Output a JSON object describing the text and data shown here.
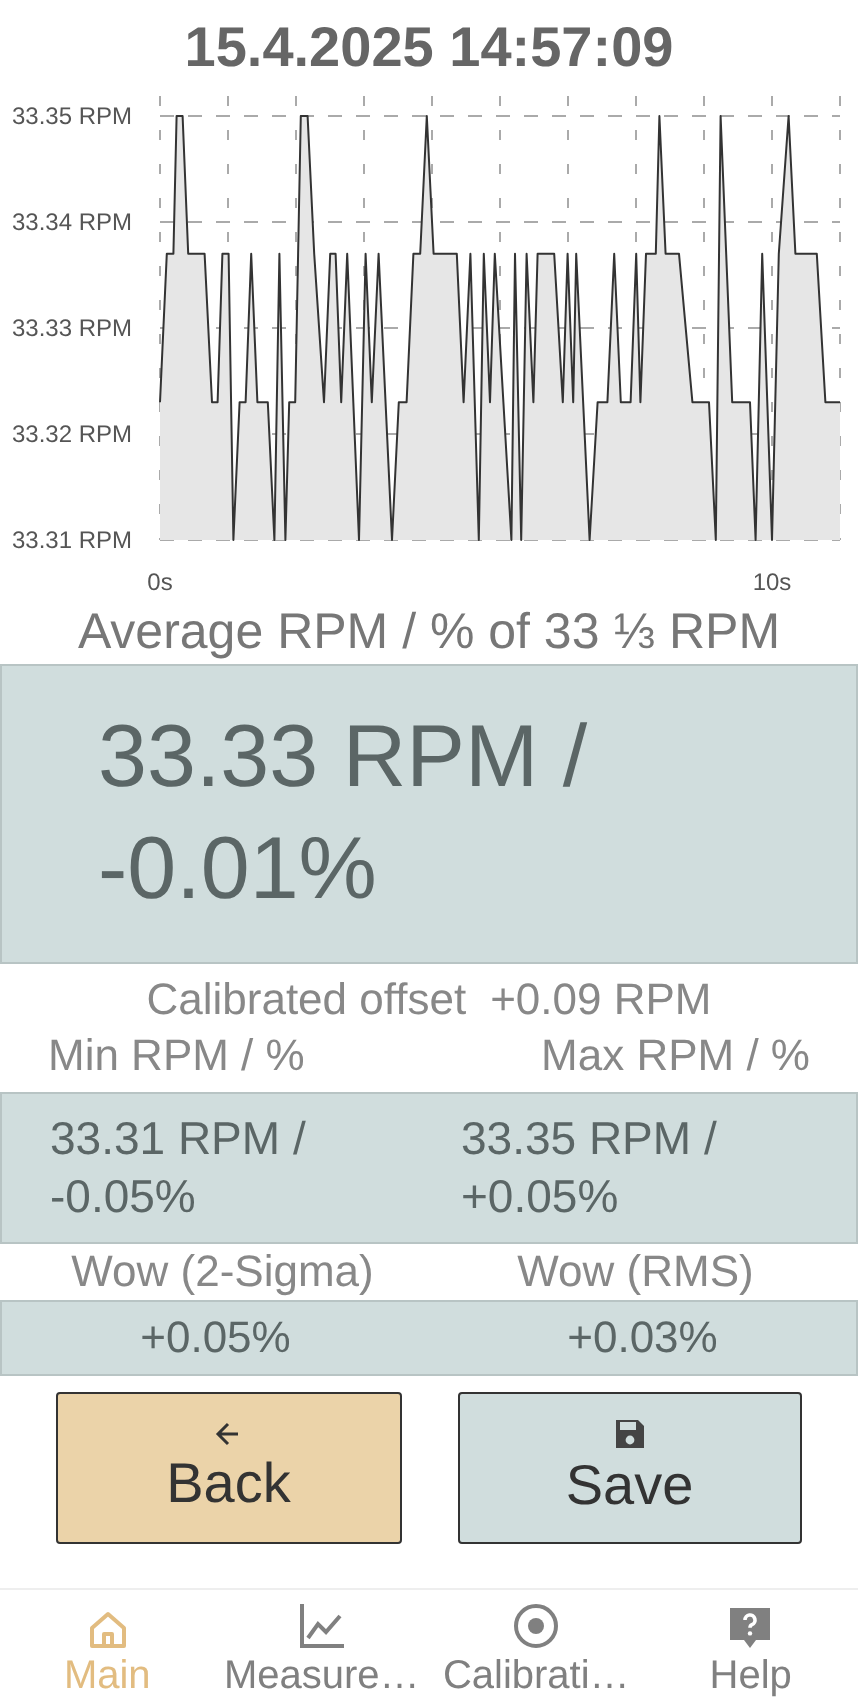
{
  "title": "15.4.2025 14:57:09",
  "chart": {
    "chart_data": {
      "type": "area",
      "x": [
        0,
        0.11,
        0.22,
        0.27,
        0.37,
        0.46,
        0.73,
        0.85,
        0.94,
        1.02,
        1.12,
        1.2,
        1.3,
        1.4,
        1.49,
        1.59,
        1.76,
        1.87,
        1.95,
        2.05,
        2.11,
        2.21,
        2.3,
        2.41,
        2.52,
        2.68,
        2.78,
        2.87,
        2.96,
        3.06,
        3.25,
        3.36,
        3.46,
        3.57,
        3.79,
        3.9,
        4.03,
        4.14,
        4.25,
        4.36,
        4.47,
        4.85,
        4.96,
        5.07,
        5.21,
        5.29,
        5.39,
        5.47,
        5.61,
        5.74,
        5.8,
        5.9,
        5.99,
        6.1,
        6.17,
        6.44,
        6.58,
        6.66,
        6.75,
        6.8,
        7.02,
        7.15,
        7.31,
        7.42,
        7.53,
        7.69,
        7.78,
        7.85,
        7.94,
        8.1,
        8.16,
        8.26,
        8.48,
        8.7,
        8.97,
        9.08,
        9.16,
        9.35,
        9.64,
        9.73,
        9.84,
        10,
        10.11,
        10.27,
        10.38,
        10.73,
        10.87,
        11.11
      ],
      "series": [
        {
          "color": "#333333",
          "values": [
            33.323,
            33.337,
            33.337,
            33.35,
            33.35,
            33.337,
            33.337,
            33.323,
            33.323,
            33.337,
            33.337,
            33.31,
            33.323,
            33.323,
            33.337,
            33.323,
            33.323,
            33.31,
            33.337,
            33.31,
            33.323,
            33.323,
            33.35,
            33.35,
            33.337,
            33.323,
            33.337,
            33.337,
            33.323,
            33.337,
            33.31,
            33.337,
            33.323,
            33.337,
            33.31,
            33.323,
            33.323,
            33.337,
            33.337,
            33.35,
            33.337,
            33.337,
            33.323,
            33.337,
            33.31,
            33.337,
            33.323,
            33.337,
            33.323,
            33.31,
            33.337,
            33.31,
            33.337,
            33.323,
            33.337,
            33.337,
            33.323,
            33.337,
            33.323,
            33.337,
            33.31,
            33.323,
            33.323,
            33.337,
            33.323,
            33.323,
            33.337,
            33.323,
            33.337,
            33.337,
            33.35,
            33.337,
            33.337,
            33.323,
            33.323,
            33.31,
            33.35,
            33.323,
            33.323,
            33.31,
            33.337,
            33.31,
            33.337,
            33.35,
            33.337,
            33.337,
            33.323,
            33.323
          ]
        }
      ],
      "grid": true,
      "xlim": [
        0,
        11.11
      ],
      "ylim": [
        33.31,
        33.35
      ],
      "xticks": [
        {
          "value": 0,
          "label": "0s"
        },
        {
          "value": 10,
          "label": "10s"
        }
      ],
      "yticks": [
        {
          "value": 33.35,
          "label": "33.35 RPM"
        },
        {
          "value": 33.34,
          "label": "33.34 RPM"
        },
        {
          "value": 33.33,
          "label": "33.33 RPM"
        },
        {
          "value": 33.32,
          "label": "33.32 RPM"
        },
        {
          "value": 33.31,
          "label": "33.31 RPM"
        }
      ]
    }
  },
  "average": {
    "label": "Average RPM / % of 33 ⅓ RPM",
    "value": "33.33 RPM / -0.01%"
  },
  "calibrated_offset": {
    "label": "Calibrated offset",
    "value": "+0.09 RPM"
  },
  "stats": [
    {
      "label": "Min RPM / %",
      "value": "33.31 RPM / -0.05%"
    },
    {
      "label": "Max RPM / %",
      "value": "33.35 RPM / +0.05%"
    }
  ],
  "wow": [
    {
      "label": "Wow (2-Sigma)",
      "value": "+0.05%"
    },
    {
      "label": "Wow (RMS)",
      "value": "+0.03%"
    }
  ],
  "buttons": [
    {
      "kind": "back",
      "label": "Back"
    },
    {
      "kind": "save",
      "label": "Save"
    }
  ],
  "nav": [
    {
      "kind": "home",
      "label": "Main",
      "selected": true
    },
    {
      "kind": "chart",
      "label": "Measure…",
      "selected": false
    },
    {
      "kind": "target",
      "label": "Calibrati…",
      "selected": false
    },
    {
      "kind": "help",
      "label": "Help",
      "selected": false
    }
  ]
}
